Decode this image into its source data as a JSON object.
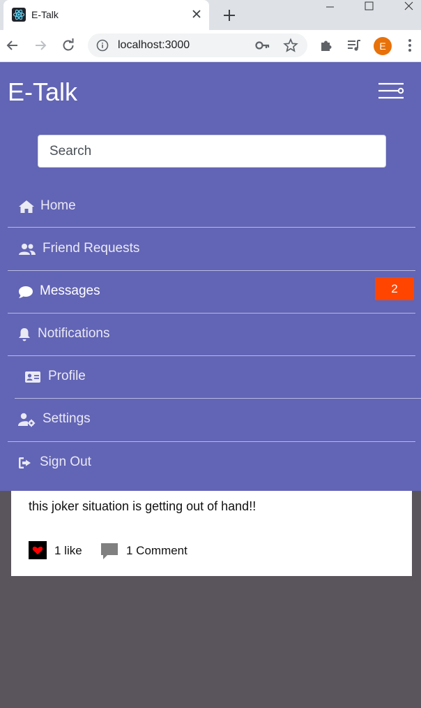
{
  "browser": {
    "tab_title": "E-Talk",
    "url": "localhost:3000",
    "profile_initial": "E"
  },
  "app": {
    "brand": "E-Talk",
    "search_placeholder": "Search",
    "nav": [
      {
        "label": "Home",
        "icon": "home-icon"
      },
      {
        "label": "Friend Requests",
        "icon": "users-icon"
      },
      {
        "label": "Messages",
        "icon": "comment-icon",
        "badge": "2"
      },
      {
        "label": "Notifications",
        "icon": "bell-icon"
      },
      {
        "label": "Profile",
        "icon": "id-card-icon"
      },
      {
        "label": "Settings",
        "icon": "user-cog-icon"
      },
      {
        "label": "Sign Out",
        "icon": "sign-out-icon"
      }
    ],
    "accent_color": "#6264b5",
    "badge_color": "#ff4500"
  },
  "post": {
    "text": "this joker situation is getting out of hand!!",
    "likes": "1 like",
    "comments": "1 Comment"
  }
}
